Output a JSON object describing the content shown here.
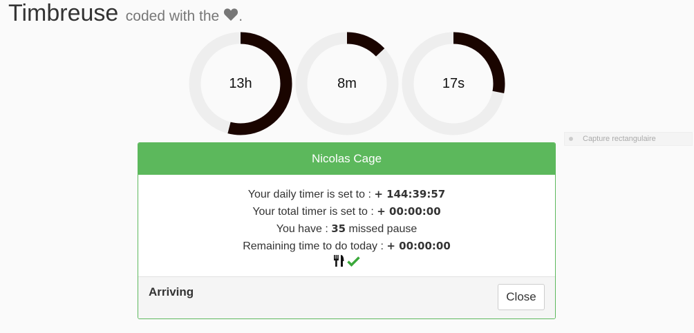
{
  "header": {
    "title": "Timbreuse",
    "tagline": "coded with the",
    "tagline_end": ".",
    "heart_icon": "heart-icon"
  },
  "timers": [
    {
      "label": "13h",
      "fraction": 0.54
    },
    {
      "label": "8m",
      "fraction": 0.13
    },
    {
      "label": "17s",
      "fraction": 0.28
    }
  ],
  "timer_colors": {
    "track": "#eeeeee",
    "progress": "#1a0500"
  },
  "ghost_tooltip": {
    "label": "Capture rectangulaire"
  },
  "modal": {
    "title": "Nicolas Cage",
    "accent": "#5cb85c",
    "daily_label": "Your daily timer is set to :",
    "daily_value": "+ 144:39:57",
    "total_label": "Your total timer is set to :",
    "total_value": "+ 00:00:00",
    "missed_prefix": "You have :",
    "missed_count": "35",
    "missed_suffix": "missed pause",
    "remaining_label": "Remaining time to do today :",
    "remaining_value": "+ 00:00:00",
    "icons": [
      "utensils-icon",
      "checkmark-icon"
    ],
    "status": "Arriving",
    "close_label": "Close"
  }
}
